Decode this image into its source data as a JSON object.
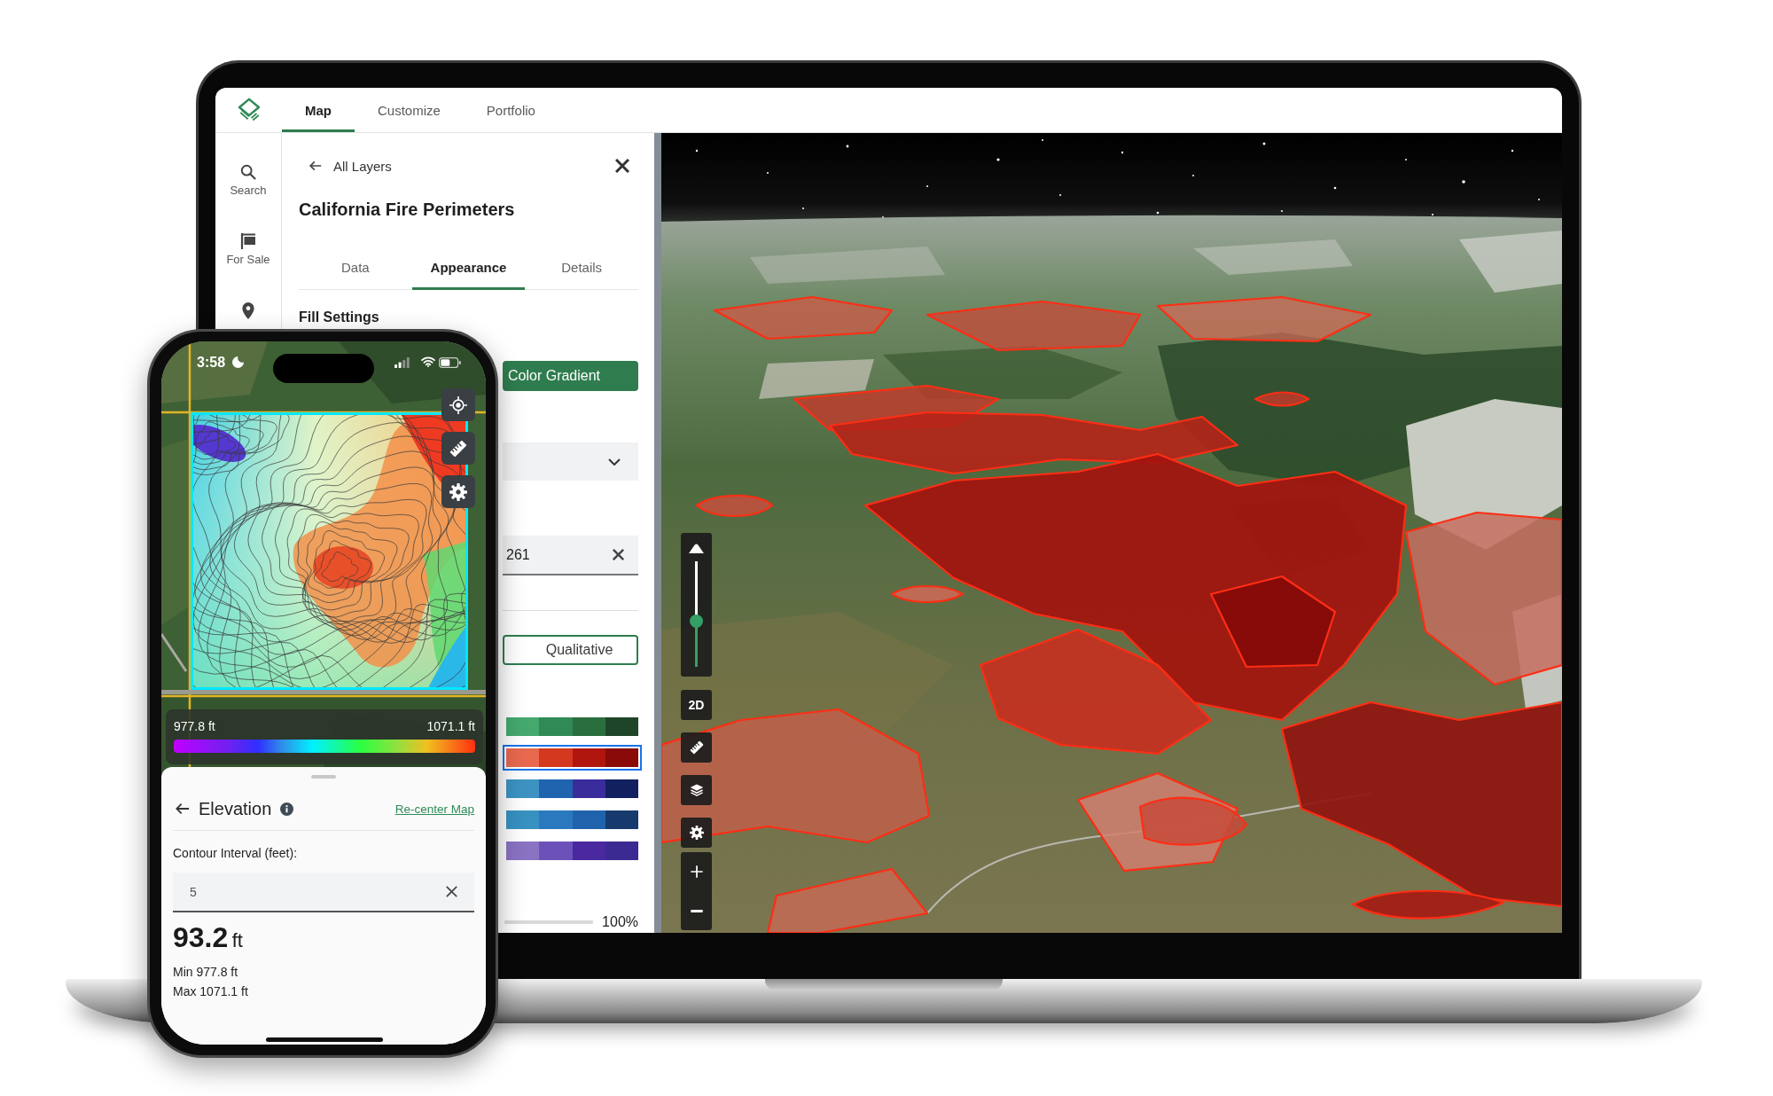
{
  "app_header": {
    "tabs": [
      {
        "label": "Map",
        "selected": true
      },
      {
        "label": "Customize",
        "selected": false
      },
      {
        "label": "Portfolio",
        "selected": false
      }
    ]
  },
  "sidebar": {
    "items": [
      {
        "kind": "search",
        "label": "Search"
      },
      {
        "kind": "flag",
        "label": "For Sale"
      },
      {
        "kind": "pin"
      }
    ]
  },
  "layer_panel": {
    "back_link": "All Layers",
    "title": "California Fire Perimeters",
    "tabs": [
      {
        "label": "Data",
        "selected": false
      },
      {
        "label": "Appearance",
        "selected": true
      },
      {
        "label": "Details",
        "selected": false
      }
    ],
    "section_title": "Fill Settings",
    "controls": [
      {
        "kind": "segment",
        "label": "Color Gradient",
        "selected": true
      },
      {
        "kind": "select"
      },
      {
        "kind": "text",
        "value": "261"
      },
      {
        "kind": "divider"
      },
      {
        "kind": "segment",
        "label": "Qualitative",
        "selected": false
      }
    ],
    "color_ramps": [
      {
        "selected": false,
        "swatches": [
          {
            "color": "#45a96e"
          },
          {
            "color": "#2f8a55"
          },
          {
            "color": "#2b6e3e"
          },
          {
            "color": "#1f4528"
          }
        ]
      },
      {
        "selected": true,
        "swatches": [
          {
            "color": "#e8694e"
          },
          {
            "color": "#d4381f"
          },
          {
            "color": "#b0160e"
          },
          {
            "color": "#8a0a0a"
          }
        ]
      },
      {
        "selected": false,
        "swatches": [
          {
            "color": "#3c93c2"
          },
          {
            "color": "#2064b0"
          },
          {
            "color": "#3b2c9c"
          },
          {
            "color": "#11205e"
          }
        ]
      },
      {
        "selected": false,
        "swatches": [
          {
            "color": "#3791c1"
          },
          {
            "color": "#2a78be"
          },
          {
            "color": "#2162ac"
          },
          {
            "color": "#163a6e"
          }
        ]
      },
      {
        "selected": false,
        "swatches": [
          {
            "color": "#8a73c2"
          },
          {
            "color": "#6c52b8"
          },
          {
            "color": "#4a28a0"
          },
          {
            "color": "#3b2a92"
          }
        ]
      }
    ],
    "opacity": {
      "level": 1,
      "reading": "100%"
    }
  },
  "map_controls": {
    "tilt": {
      "level": 0.43
    },
    "buttons": [
      {
        "kind": "view",
        "label": "2D"
      },
      {
        "kind": "ruler"
      },
      {
        "kind": "layers"
      },
      {
        "kind": "settings"
      }
    ],
    "zoom": [
      {
        "kind": "zoomin"
      },
      {
        "kind": "zoomout"
      }
    ]
  },
  "phone": {
    "status_bar": {
      "time": "3:58"
    },
    "map_buttons": [
      {
        "kind": "locate"
      },
      {
        "kind": "ruler"
      },
      {
        "kind": "settings"
      }
    ],
    "legend": {
      "min": "977.8 ft",
      "max": "1071.1 ft"
    },
    "sheet": {
      "title": "Elevation",
      "link": "Re-center Map",
      "field_label": "Contour Interval (feet):",
      "field_value": "5",
      "value": "93.2",
      "unit": "ft",
      "min_line": "Min 977.8 ft",
      "max_line": "Max 1071.1 ft"
    }
  }
}
